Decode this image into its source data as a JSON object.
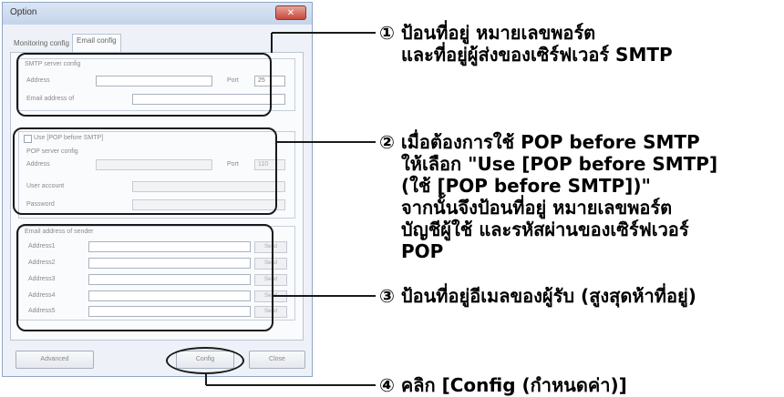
{
  "dialog": {
    "title": "Option",
    "close_label": "✕",
    "tabs": [
      "Monitoring config",
      "Email config"
    ],
    "smtp": {
      "group_label": "SMTP server config",
      "address_label": "Address",
      "port_label": "Port",
      "port_value": "25",
      "sender_label": "Email address of"
    },
    "pop": {
      "checkbox_label": "Use [POP before SMTP]",
      "group_label": "POP server config",
      "address_label": "Address",
      "port_label": "Port",
      "port_value": "110",
      "account_label": "User account",
      "password_label": "Password"
    },
    "recipients": {
      "group_label": "Email address of sender",
      "rows": [
        "Address1",
        "Address2",
        "Address3",
        "Address4",
        "Address5"
      ],
      "button_label": "Send"
    },
    "buttons": {
      "advanced": "Advanced",
      "config": "Config",
      "close": "Close"
    }
  },
  "annotations": {
    "n1": {
      "marker": "①",
      "lines": [
        "ป้อนที่อยู่ หมายเลขพอร์ต",
        "และที่อยู่ผู้ส่งของเซิร์ฟเวอร์ SMTP"
      ]
    },
    "n2": {
      "marker": "②",
      "lines": [
        "เมื่อต้องการใช้ POP before SMTP",
        "ให้เลือก \"Use [POP before SMTP]",
        "(ใช้ [POP before SMTP])\"",
        "จากนั้นจึงป้อนที่อยู่ หมายเลขพอร์ต",
        "บัญชีผู้ใช้ และรหัสผ่านของเซิร์ฟเวอร์",
        "POP"
      ]
    },
    "n3": {
      "marker": "③",
      "lines": [
        "ป้อนที่อยู่อีเมลของผู้รับ (สูงสุดห้าที่อยู่)"
      ]
    },
    "n4": {
      "marker": "④",
      "lines": [
        "คลิก [Config (กำหนดค่า)]"
      ]
    }
  }
}
